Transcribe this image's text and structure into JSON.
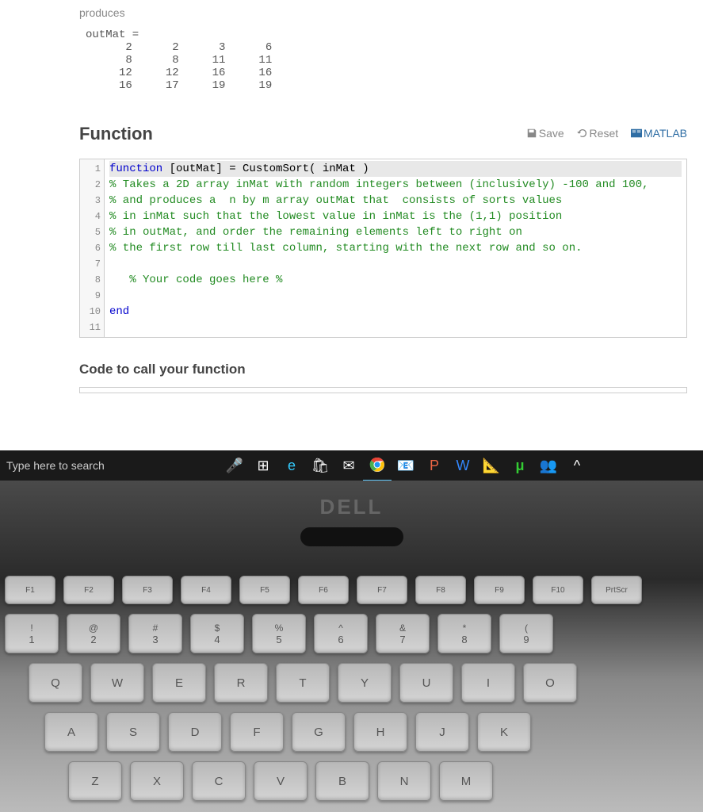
{
  "producesLabel": "produces",
  "outputHeader": "outMat =",
  "output": "      2      2      3      6\n      8      8     11     11\n     12     12     16     16\n     16     17     19     19",
  "functionHeader": "Function",
  "toolbar": {
    "save": "Save",
    "reset": "Reset",
    "matlab": "MATLAB"
  },
  "code": [
    {
      "n": 1,
      "type": "def",
      "kw": "function",
      "rest": " [outMat] = CustomSort( inMat )"
    },
    {
      "n": 2,
      "type": "cm",
      "t": "% Takes a 2D array inMat with random integers between (inclusively) -100 and 100,"
    },
    {
      "n": 3,
      "type": "cm",
      "t": "% and produces a  n by m array outMat that  consists of sorts values"
    },
    {
      "n": 4,
      "type": "cm",
      "t": "% in inMat such that the lowest value in inMat is the (1,1) position"
    },
    {
      "n": 5,
      "type": "cm",
      "t": "% in outMat, and order the remaining elements left to right on"
    },
    {
      "n": 6,
      "type": "cm",
      "t": "% the first row till last column, starting with the next row and so on."
    },
    {
      "n": 7,
      "type": "blank",
      "t": ""
    },
    {
      "n": 8,
      "type": "cm",
      "t": "   % Your code goes here %"
    },
    {
      "n": 9,
      "type": "blank",
      "t": ""
    },
    {
      "n": 10,
      "type": "kw",
      "t": "end"
    },
    {
      "n": 11,
      "type": "blank",
      "t": ""
    }
  ],
  "subHeader": "Code to call your function",
  "searchPlaceholder": "Type here to search",
  "dell": "DELL",
  "fnRow": [
    "F1",
    "F2",
    "F3",
    "F4",
    "F5",
    "F6",
    "F7",
    "F8",
    "F9",
    "F10",
    "PrtScr"
  ],
  "numRow": [
    [
      "!",
      "1"
    ],
    [
      "@",
      "2"
    ],
    [
      "#",
      "3"
    ],
    [
      "$",
      "4"
    ],
    [
      "%",
      "5"
    ],
    [
      "^",
      "6"
    ],
    [
      "&",
      "7"
    ],
    [
      "*",
      "8"
    ],
    [
      "(",
      "9"
    ]
  ],
  "r3": [
    "Q",
    "W",
    "E",
    "R",
    "T",
    "Y",
    "U",
    "I",
    "O"
  ],
  "r4": [
    "A",
    "S",
    "D",
    "F",
    "G",
    "H",
    "J",
    "K"
  ],
  "r5": [
    "Z",
    "X",
    "C",
    "V",
    "B",
    "N",
    "M"
  ]
}
